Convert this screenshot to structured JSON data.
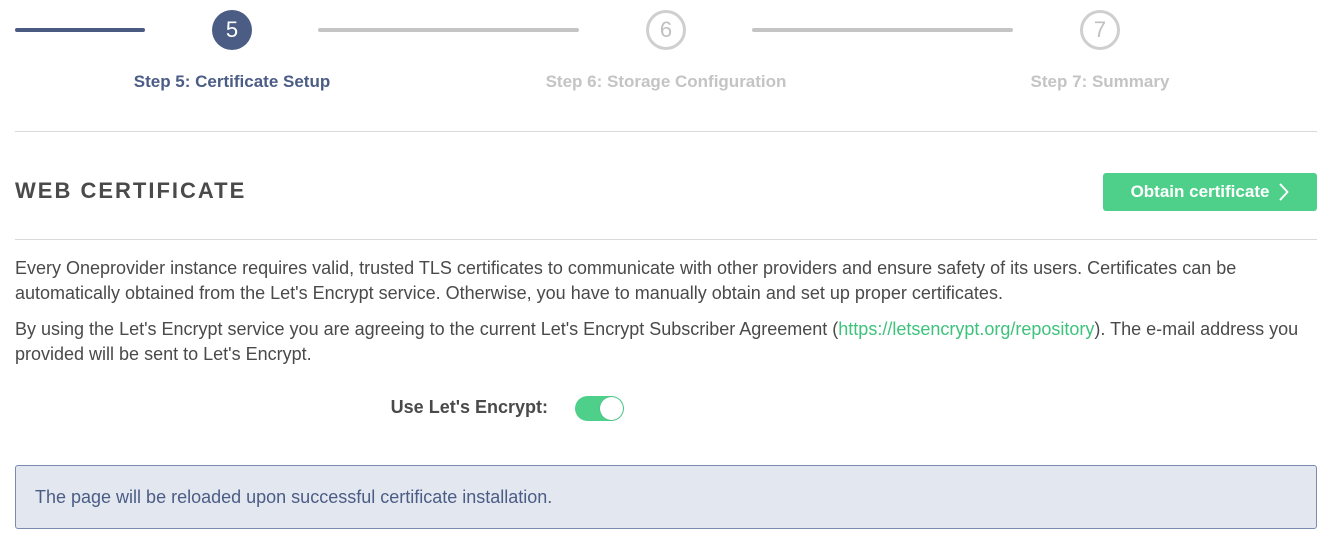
{
  "stepper": {
    "steps": [
      {
        "number": "5",
        "label": "Step 5: Certificate Setup",
        "state": "active"
      },
      {
        "number": "6",
        "label": "Step 6: Storage Configuration",
        "state": "pending"
      },
      {
        "number": "7",
        "label": "Step 7: Summary",
        "state": "pending"
      }
    ]
  },
  "section": {
    "title": "WEB CERTIFICATE",
    "obtain_button_label": "Obtain certificate"
  },
  "description": {
    "paragraph1": "Every Oneprovider instance requires valid, trusted TLS certificates to communicate with other providers and ensure safety of its users. Certificates can be automatically obtained from the Let's Encrypt service. Otherwise, you have to manually obtain and set up proper certificates.",
    "paragraph2_before": "By using the Let's Encrypt service you are agreeing to the current Let's Encrypt Subscriber Agreement (",
    "paragraph2_link": "https://letsencrypt.org/repository",
    "paragraph2_after": "). The e-mail address you provided will be sent to Let's Encrypt."
  },
  "letsencrypt_toggle": {
    "label": "Use Let's Encrypt:",
    "enabled": true
  },
  "info": {
    "message": "The page will be reloaded upon successful certificate installation."
  },
  "colors": {
    "accent": "#4fd08a",
    "primary": "#4b5c85",
    "link": "#3ec27c"
  }
}
